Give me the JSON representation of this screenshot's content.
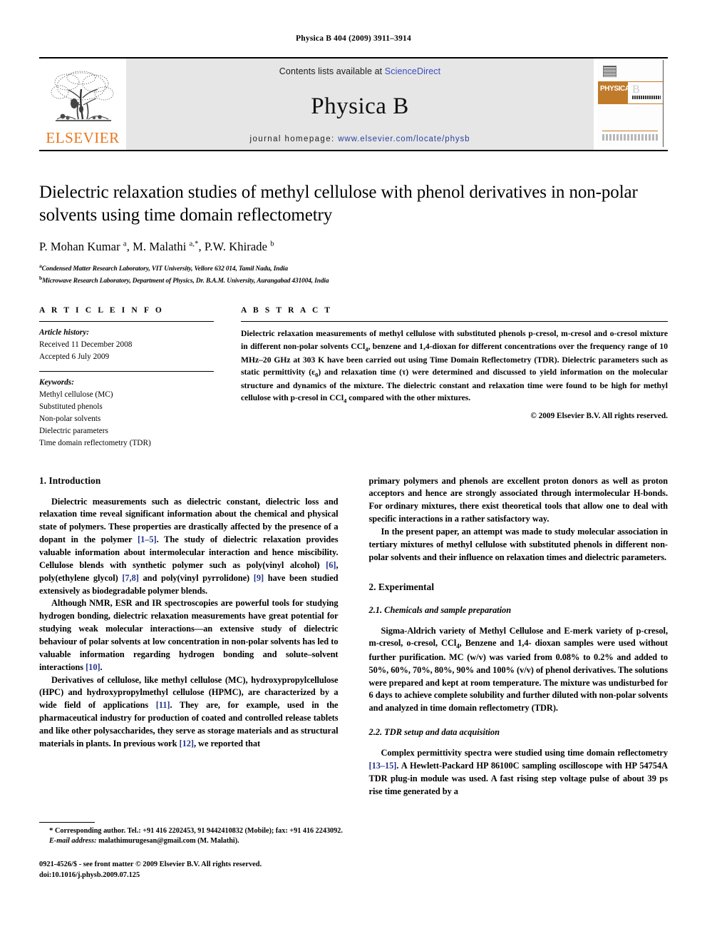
{
  "running_head": "Physica B 404 (2009) 3911–3914",
  "masthead": {
    "publisher_name": "ELSEVIER",
    "contents_prefix": "Contents lists available at ",
    "contents_link": "ScienceDirect",
    "journal_name": "Physica B",
    "homepage_prefix": "journal homepage: ",
    "homepage_link": "www.elsevier.com/locate/physb",
    "cover_band_label": "PHYSICA",
    "cover_band_letter": "B",
    "accent_orange": "#E8761B",
    "link_blue": "#2b3f9e",
    "banner_bg": "#e6e6e6"
  },
  "article": {
    "title": "Dielectric relaxation studies of methyl cellulose with phenol derivatives in non-polar solvents using time domain reflectometry",
    "authors_html": "P. Mohan Kumar <sup>a</sup>, M. Malathi <sup>a,</sup><sup>*</sup>, P.W. Khirade <sup>b</sup>",
    "affiliations": [
      "Condensed Matter Research Laboratory, VIT University, Vellore 632 014, Tamil Nadu, India",
      "Microwave Research Laboratory, Department of Physics, Dr. B.A.M. University, Aurangabad 431004, India"
    ],
    "affiliation_marks": [
      "a",
      "b"
    ]
  },
  "article_info": {
    "heading": "A R T I C L E   I N F O",
    "history_label": "Article history:",
    "history": [
      "Received 11 December 2008",
      "Accepted 6 July 2009"
    ],
    "keywords_label": "Keywords:",
    "keywords": [
      "Methyl cellulose (MC)",
      "Substituted phenols",
      "Non-polar solvents",
      "Dielectric parameters",
      "Time domain reflectometry (TDR)"
    ]
  },
  "abstract": {
    "heading": "A B S T R A C T",
    "text_html": "Dielectric relaxation measurements of methyl cellulose with substituted phenols p-cresol, m-cresol and o-cresol mixture in different non-polar solvents CCl<sub>4</sub>, benzene and 1,4-dioxan for different concentrations over the frequency range of 10 MHz–20 GHz at 303 K have been carried out using Time Domain Reflectometry (TDR). Dielectric parameters such as static permittivity (&#603;<sub>0</sub>) and relaxation time (&#964;) were determined and discussed to yield information on the molecular structure and dynamics of the mixture. The dielectric constant and relaxation time were found to be high for methyl cellulose with p-cresol in CCl<sub>4</sub> compared with the other mixtures.",
    "copyright": "© 2009 Elsevier B.V. All rights reserved."
  },
  "sections": {
    "introduction_heading": "1.  Introduction",
    "intro_p1_html": "Dielectric measurements such as dielectric constant, dielectric loss and relaxation time reveal significant information about the chemical and physical state of polymers. These properties are drastically affected by the presence of a dopant in the polymer <span class=\"ref\">[1–5]</span>. The study of dielectric relaxation provides valuable information about intermolecular interaction and hence miscibility. Cellulose blends with synthetic polymer such as poly(vinyl alcohol) <span class=\"ref\">[6]</span>, poly(ethylene glycol) <span class=\"ref\">[7,8]</span> and poly(vinyl pyrrolidone) <span class=\"ref\">[9]</span> have been studied extensively as biodegradable polymer blends.",
    "intro_p2_html": "Although NMR, ESR and IR spectroscopies are powerful tools for studying hydrogen bonding, dielectric relaxation measurements have great potential for studying weak molecular interactions—an extensive study of dielectric behaviour of polar solvents at low concentration in non-polar solvents has led to valuable information regarding hydrogen bonding and solute–solvent interactions <span class=\"ref\">[10]</span>.",
    "intro_p3_html": "Derivatives of cellulose, like methyl cellulose (MC), hydroxypropylcellulose (HPC) and hydroxypropylmethyl cellulose (HPMC), are characterized by a wide field of applications <span class=\"ref\">[11]</span>. They are, for example, used in the pharmaceutical industry for production of coated and controlled release tablets and like other polysaccharides, they serve as storage materials and as structural materials in plants. In previous work <span class=\"ref\">[12]</span>, we reported that",
    "right_p1_html": "primary polymers and phenols are excellent proton donors as well as proton acceptors and hence are strongly associated through intermolecular H-bonds. For ordinary mixtures, there exist theoretical tools that allow one to deal with specific interactions in a rather satisfactory way.",
    "right_p2_html": "In the present paper, an attempt was made to study molecular association in tertiary mixtures of methyl cellulose with substituted phenols in different non-polar solvents and their influence on relaxation times and dielectric parameters.",
    "experimental_heading": "2.  Experimental",
    "sub21_heading": "2.1.  Chemicals and sample preparation",
    "sub21_p_html": "Sigma-Aldrich variety of Methyl Cellulose and E-merk variety of p-cresol, m-cresol, o-cresol, CCl<sub class=\"s\">4</sub>, Benzene and 1,4- dioxan samples were used without further purification. MC (w/v) was varied from 0.08% to 0.2% and added to 50%, 60%, 70%, 80%, 90% and 100% (v/v) of phenol derivatives. The solutions were prepared and kept at room temperature. The mixture was undisturbed for 6 days to achieve complete solubility and further diluted with non-polar solvents and analyzed in time domain reflectometry (TDR).",
    "sub22_heading": "2.2.  TDR setup and data acquisition",
    "sub22_p_html": "Complex permittivity spectra were studied using time domain reflectometry <span class=\"ref\">[13–15]</span>. A Hewlett-Packard HP 86100C sampling oscilloscope with HP 54754A TDR plug-in module was used. A fast rising step voltage pulse of about 39 ps rise time generated by a"
  },
  "footnotes": {
    "corresponding_html": "<span class=\"star\">*</span> Corresponding author. Tel.: +91 416 2202453, 91 9442410832 (Mobile); fax: +91 416 2243092.",
    "email_html": "<span class=\"it\">E-mail address:</span> malathimurugesan@gmail.com (M. Malathi).",
    "imprint_line1": "0921-4526/$ - see front matter © 2009 Elsevier B.V. All rights reserved.",
    "imprint_line2": "doi:10.1016/j.physb.2009.07.125"
  }
}
